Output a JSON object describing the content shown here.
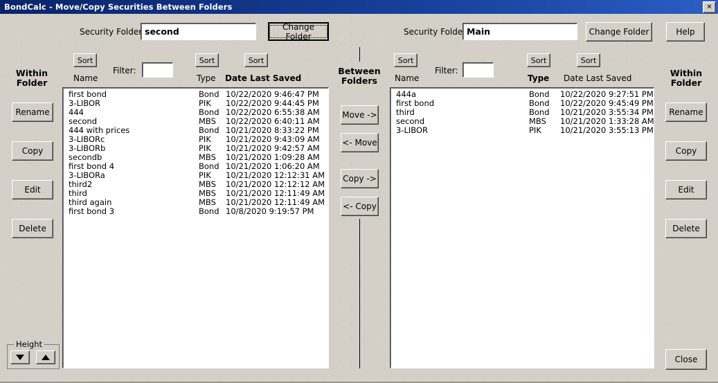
{
  "window": {
    "title": "BondCalc - Move/Copy Securities Between Folders",
    "close_glyph": "✕"
  },
  "left_panel": {
    "folder_label": "Security Folder:",
    "folder_value": "second",
    "change_folder_label": "Change Folder",
    "sort_name_label": "Sort",
    "sort_type_label": "Sort",
    "sort_date_label": "Sort",
    "col_name": "Name",
    "col_type": "Type",
    "col_date": "Date Last Saved",
    "filter_label": "Filter:",
    "filter_value": "",
    "within_folder_title": "Within\nFolder",
    "within_folder_title_line1": "Within",
    "within_folder_title_line2": "Folder",
    "rename_label": "Rename",
    "copy_label": "Copy",
    "edit_label": "Edit",
    "delete_label": "Delete",
    "height_group_label": "Height",
    "height_down_glyph": "▼",
    "height_up_glyph": "▲",
    "rows": [
      {
        "name": "first bond",
        "type": "Bond",
        "date": "10/22/2020 9:46:47 PM"
      },
      {
        "name": "3-LIBOR",
        "type": "PIK",
        "date": "10/22/2020 9:44:45 PM"
      },
      {
        "name": "444",
        "type": "Bond",
        "date": "10/22/2020 6:55:38 AM"
      },
      {
        "name": "second",
        "type": "MBS",
        "date": "10/22/2020 6:40:11 AM"
      },
      {
        "name": "444 with prices",
        "type": "Bond",
        "date": "10/21/2020 8:33:22 PM"
      },
      {
        "name": "3-LIBORc",
        "type": "PIK",
        "date": "10/21/2020 9:43:09 AM"
      },
      {
        "name": "3-LIBORb",
        "type": "PIK",
        "date": "10/21/2020 9:42:57 AM"
      },
      {
        "name": "secondb",
        "type": "MBS",
        "date": "10/21/2020 1:09:28 AM"
      },
      {
        "name": "first bond 4",
        "type": "Bond",
        "date": "10/21/2020 1:06:20 AM"
      },
      {
        "name": "3-LIBORa",
        "type": "PIK",
        "date": "10/21/2020 12:12:31 AM"
      },
      {
        "name": "third2",
        "type": "MBS",
        "date": "10/21/2020 12:12:12 AM"
      },
      {
        "name": "third",
        "type": "MBS",
        "date": "10/21/2020 12:11:49 AM"
      },
      {
        "name": "third again",
        "type": "MBS",
        "date": "10/21/2020 12:11:49 AM"
      },
      {
        "name": "first bond 3",
        "type": "Bond",
        "date": "10/8/2020 9:19:57 PM"
      }
    ]
  },
  "middle_panel": {
    "title_line1": "Between",
    "title_line2": "Folders",
    "move_right_label": "Move ->",
    "move_left_label": "<- Move",
    "copy_right_label": "Copy ->",
    "copy_left_label": "<- Copy"
  },
  "right_panel": {
    "folder_label": "Security Folder:",
    "folder_value": "Main",
    "change_folder_label": "Change Folder",
    "help_label": "Help",
    "sort_name_label": "Sort",
    "sort_type_label": "Sort",
    "sort_date_label": "Sort",
    "col_name": "Name",
    "col_type": "Type",
    "col_date": "Date Last Saved",
    "filter_label": "Filter:",
    "filter_value": "",
    "within_folder_title_line1": "Within",
    "within_folder_title_line2": "Folder",
    "rename_label": "Rename",
    "copy_label": "Copy",
    "edit_label": "Edit",
    "delete_label": "Delete",
    "close_label": "Close",
    "rows": [
      {
        "name": "444a",
        "type": "Bond",
        "date": "10/22/2020 9:27:51 PM"
      },
      {
        "name": "first bond",
        "type": "Bond",
        "date": "10/22/2020 9:45:49 PM"
      },
      {
        "name": "third",
        "type": "Bond",
        "date": "10/21/2020 3:55:34 PM"
      },
      {
        "name": "second",
        "type": "MBS",
        "date": "10/21/2020 1:33:28 AM"
      },
      {
        "name": "3-LIBOR",
        "type": "PIK",
        "date": "10/21/2020 3:55:13 PM"
      }
    ]
  },
  "colors": {
    "titlebar_start": "#0a246a",
    "titlebar_end": "#2b5ec4",
    "dialog_face": "#d4d0c8",
    "field_bg": "#ffffff",
    "text": "#000000"
  }
}
